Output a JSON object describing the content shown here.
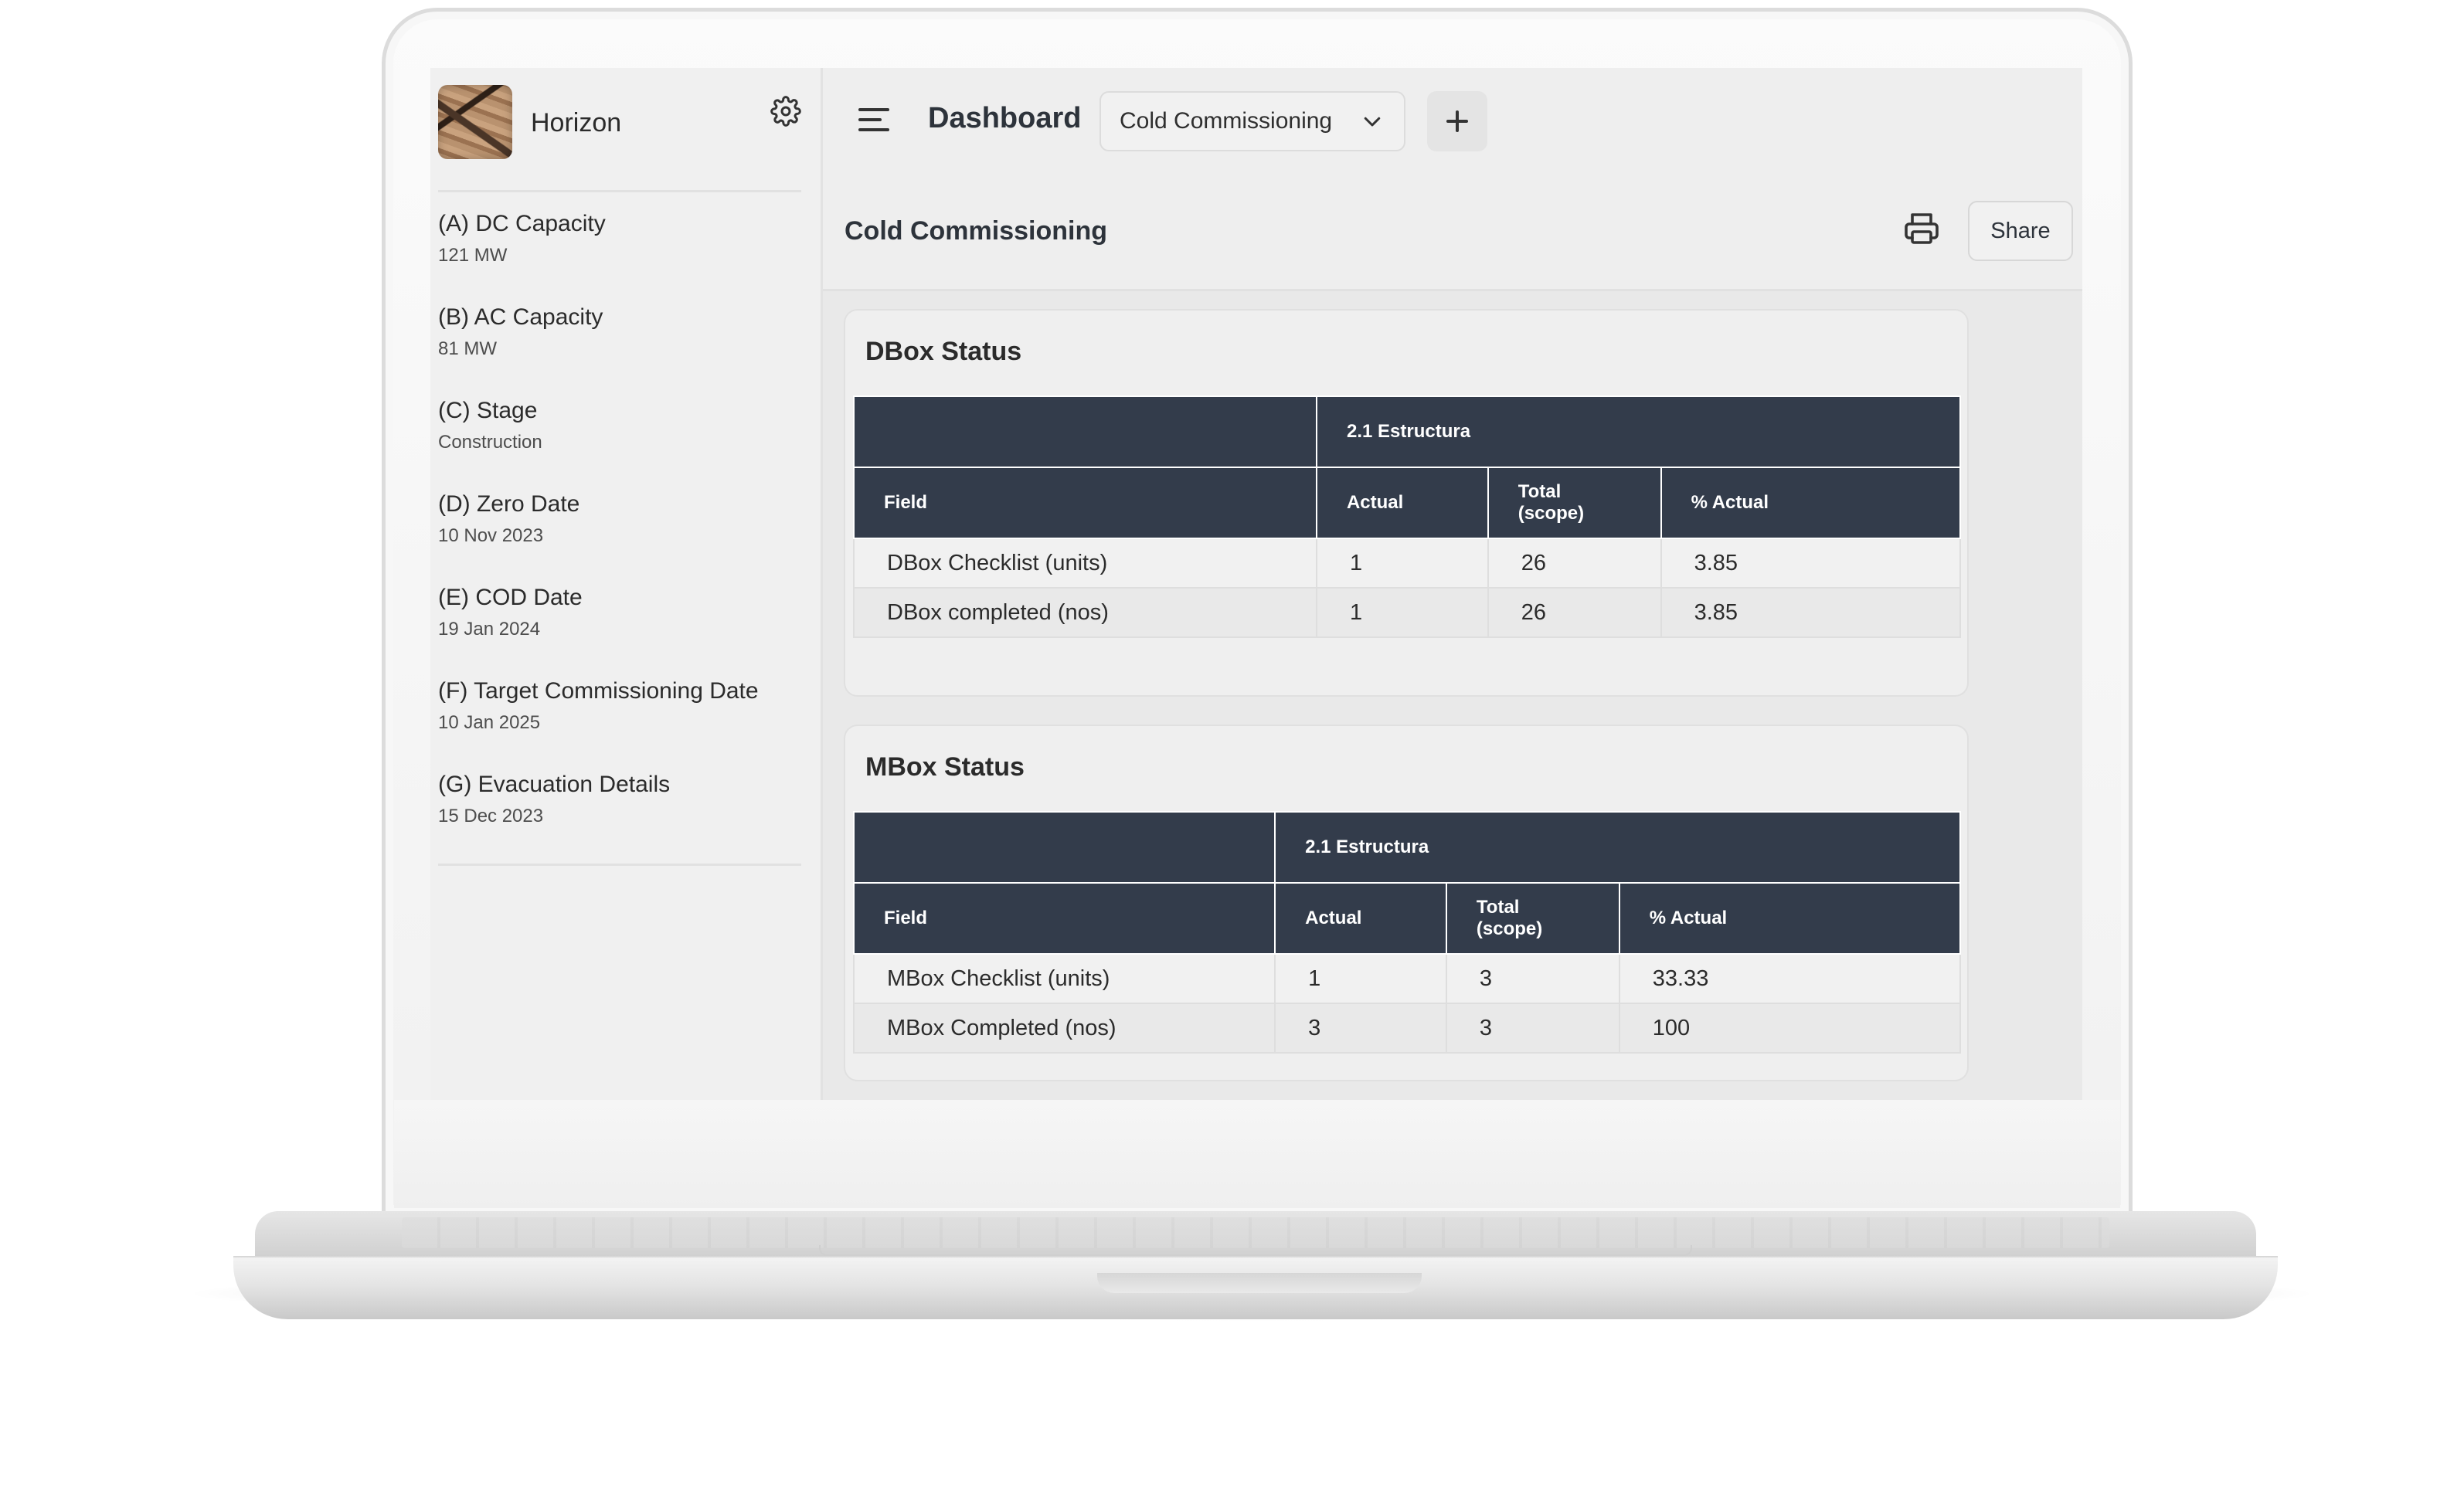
{
  "app": {
    "name": "Horizon"
  },
  "sidebar": {
    "items": [
      {
        "label": "(A) DC Capacity",
        "value": "121 MW"
      },
      {
        "label": "(B) AC Capacity",
        "value": "81 MW"
      },
      {
        "label": "(C) Stage",
        "value": "Construction"
      },
      {
        "label": "(D) Zero Date",
        "value": "10 Nov 2023"
      },
      {
        "label": "(E) COD Date",
        "value": "19 Jan 2024"
      },
      {
        "label": "(F) Target Commissioning Date",
        "value": "10 Jan 2025"
      },
      {
        "label": "(G) Evacuation Details",
        "value": "15 Dec 2023"
      }
    ]
  },
  "header": {
    "title": "Dashboard",
    "dashboard_select": "Cold Commissioning"
  },
  "section": {
    "title": "Cold Commissioning",
    "share_label": "Share"
  },
  "cards": [
    {
      "title": "DBox Status",
      "group_header": "2.1 Estructura",
      "columns": [
        "Field",
        "Actual",
        "Total (scope)",
        "% Actual"
      ],
      "rows": [
        [
          "DBox Checklist (units)",
          "1",
          "26",
          "3.85"
        ],
        [
          "DBox completed (nos)",
          "1",
          "26",
          "3.85"
        ]
      ]
    },
    {
      "title": "MBox Status",
      "group_header": "2.1 Estructura",
      "columns": [
        "Field",
        "Actual",
        "Total (scope)",
        "% Actual"
      ],
      "rows": [
        [
          "MBox Checklist (units)",
          "1",
          "3",
          "33.33"
        ],
        [
          "MBox Completed (nos)",
          "3",
          "3",
          "100"
        ]
      ]
    }
  ],
  "colors": {
    "table_header": "#333c4b",
    "background": "#eeeeee"
  },
  "icons": [
    "gear-icon",
    "menu-icon",
    "chevron-down-icon",
    "plus-icon",
    "printer-icon"
  ]
}
